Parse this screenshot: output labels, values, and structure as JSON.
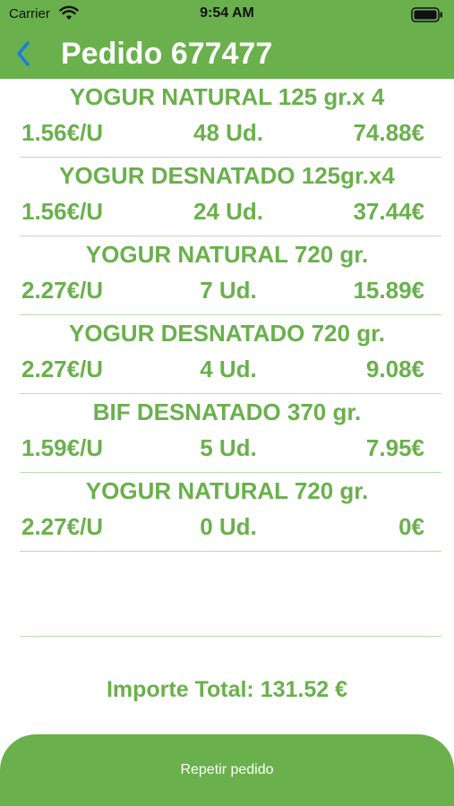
{
  "status": {
    "carrier": "Carrier",
    "time": "9:54 AM"
  },
  "header": {
    "title": "Pedido 677477",
    "back_icon": "chevron-left-icon"
  },
  "items": [
    {
      "name": "YOGUR NATURAL 125 gr.x 4",
      "price": "1.56€/U",
      "qty": "48 Ud.",
      "total": "74.88€"
    },
    {
      "name": "YOGUR DESNATADO 125gr.x4",
      "price": "1.56€/U",
      "qty": "24 Ud.",
      "total": "37.44€"
    },
    {
      "name": "YOGUR NATURAL 720 gr.",
      "price": "2.27€/U",
      "qty": "7 Ud.",
      "total": "15.89€"
    },
    {
      "name": "YOGUR DESNATADO 720 gr.",
      "price": "2.27€/U",
      "qty": "4 Ud.",
      "total": "9.08€"
    },
    {
      "name": "BIF DESNATADO 370 gr.",
      "price": "1.59€/U",
      "qty": "5 Ud.",
      "total": "7.95€"
    },
    {
      "name": "YOGUR NATURAL 720 gr.",
      "price": "2.27€/U",
      "qty": "0 Ud.",
      "total": "0€"
    }
  ],
  "summary": {
    "total_label": "Importe Total: 131.52 €"
  },
  "actions": {
    "repeat_label": "Repetir pedido"
  },
  "colors": {
    "accent": "#6ab04c",
    "back_arrow": "#1a7be0",
    "divider": "#b8deb0"
  }
}
